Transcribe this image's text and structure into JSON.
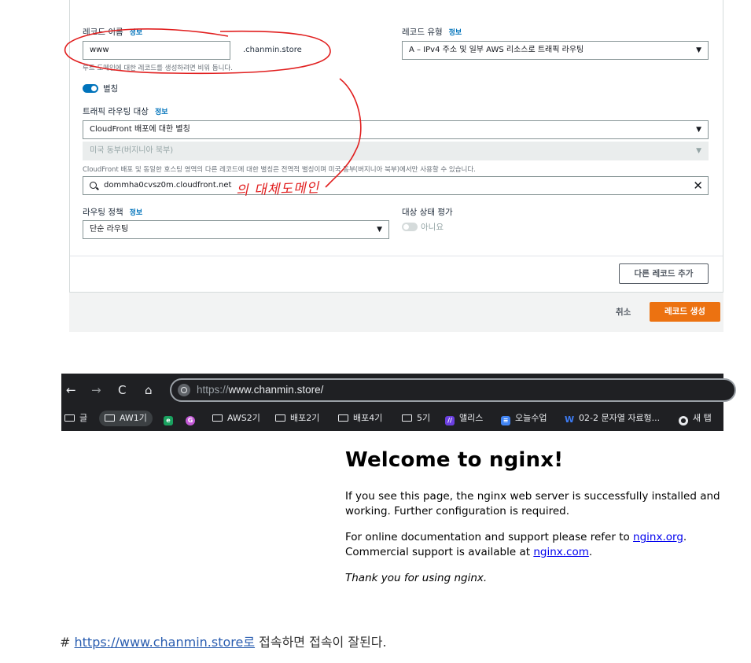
{
  "route53": {
    "record_name_label": "레코드 이름",
    "info_label": "정보",
    "record_name_value": "www",
    "domain_suffix": ".chanmin.store",
    "record_name_hint": "루트 도메인에 대한 레코드를 생성하려면 비워 둡니다.",
    "record_type_label": "레코드 유형",
    "record_type_value": "A – IPv4 주소 및 일부 AWS 리소스로 트래픽 라우팅",
    "alias_label": "별칭",
    "alias_enabled": true,
    "target_label": "트래픽 라우팅 대상",
    "target_type_value": "CloudFront 배포에 대한 별칭",
    "region_value": "미국 동부(버지니아 북부)",
    "region_hint": "CloudFront 배포 및 동일한 호스팅 영역의 다른 레코드에 대한 별칭은 전역적 별칭이며 미국 동부(버지니아 북부)에서만 사용할 수 있습니다.",
    "target_value": "dommha0cvsz0m.cloudfront.net",
    "routing_policy_label": "라우팅 정책",
    "routing_policy_value": "단순 라우팅",
    "health_label": "대상 상태 평가",
    "health_value": "아니요",
    "health_enabled": false,
    "add_record_label": "다른 레코드 추가",
    "cancel_label": "취소",
    "create_label": "레코드 생성"
  },
  "annotation": {
    "text": "의 대체도메인",
    "color": "#e11f1f"
  },
  "browser": {
    "url_scheme": "https://",
    "url_host": "www.chanmin.store/",
    "bookmarks": [
      {
        "label": "글",
        "icon": "folder-icon"
      },
      {
        "label": "AW1기",
        "icon": "folder-icon"
      },
      {
        "label": "",
        "icon": "edge-icon"
      },
      {
        "label": "",
        "icon": "grammarly-icon"
      },
      {
        "label": "AWS2기",
        "icon": "folder-icon"
      },
      {
        "label": "배포2기",
        "icon": "folder-icon"
      },
      {
        "label": "배포4기",
        "icon": "folder-icon"
      },
      {
        "label": "5기",
        "icon": "folder-icon"
      },
      {
        "label": "앨리스",
        "icon": "elice-icon"
      },
      {
        "label": "오늘수업",
        "icon": "docs-icon"
      },
      {
        "label": "02-2 문자열 자료형...",
        "icon": "wikidocs-icon"
      },
      {
        "label": "새 탭",
        "icon": "globe-icon"
      }
    ]
  },
  "nginx": {
    "title": "Welcome to nginx!",
    "para1": "If you see this page, the nginx web server is successfully installed and working. Further configuration is required.",
    "para2_prefix": "For online documentation and support please refer to ",
    "link1": "nginx.org",
    "para2_mid": ".",
    "para2_line2_prefix": "Commercial support is available at ",
    "link2": "nginx.com",
    "para2_suffix": ".",
    "thanks": "Thank you for using nginx."
  },
  "note": {
    "prefix": "# ",
    "link": "https://www.chanmin.store로",
    "text": " 접속하면 접속이 잘된다."
  }
}
